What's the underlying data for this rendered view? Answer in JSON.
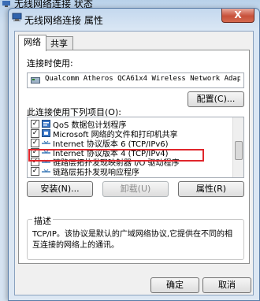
{
  "background_window": {
    "title": "无线网络连接 状态"
  },
  "dialog": {
    "title": "无线网络连接 属性",
    "close_glyph": "X"
  },
  "tabs": [
    {
      "label": "网络"
    },
    {
      "label": "共享"
    }
  ],
  "connect_using": {
    "label": "连接时使用:",
    "adapter": "Qualcomm Atheros QCA61x4 Wireless Network Adap",
    "configure_button": "配置(C)..."
  },
  "items_label": "此连接使用下列项目(O):",
  "items": [
    {
      "label": "QoS 数据包计划程序",
      "checked": true,
      "icon": "qos-icon"
    },
    {
      "label": "Microsoft 网络的文件和打印机共享",
      "checked": true,
      "icon": "share-icon"
    },
    {
      "label": "Internet 协议版本 6 (TCP/IPv6)",
      "checked": true,
      "icon": "protocol-icon"
    },
    {
      "label": "Internet 协议版本 4 (TCP/IPv4)",
      "checked": true,
      "icon": "protocol-icon"
    },
    {
      "label": "链路层拓扑发现映射器 I/O 驱动程序",
      "checked": true,
      "icon": "protocol-icon"
    },
    {
      "label": "链路层拓扑发现响应程序",
      "checked": true,
      "icon": "protocol-icon"
    }
  ],
  "buttons": {
    "install": "安装(N)...",
    "uninstall": "卸载(U)",
    "properties": "属性(R)"
  },
  "description": {
    "title": "描述",
    "text": "TCP/IP。该协议是默认的广域网络协议,它提供在不同的相互连接的网络上的通讯。"
  },
  "footer": {
    "ok": "确定",
    "cancel": "取消"
  },
  "colors": {
    "highlight": "#e0262c"
  }
}
